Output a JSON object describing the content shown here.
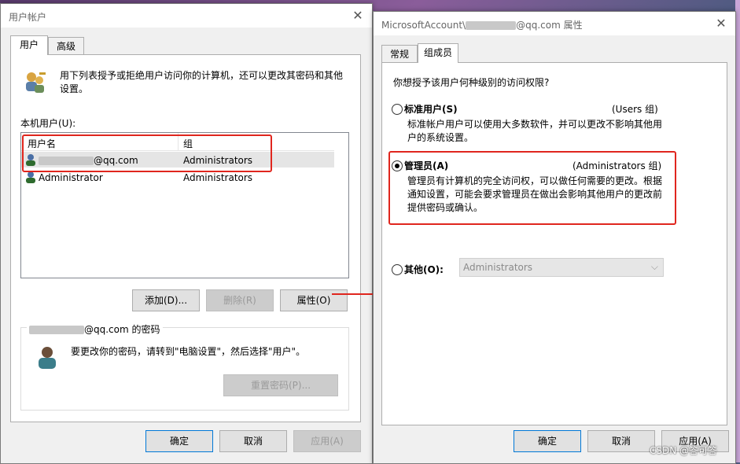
{
  "taskbar_right": {
    "watermark": "CSDN @答可答"
  },
  "left_dialog": {
    "title": "用户帐户",
    "tabs": [
      "用户",
      "高级"
    ],
    "intro": "用下列表授予或拒绝用户访问你的计算机，还可以更改其密码和其他设置。",
    "users_label": "本机用户(U):",
    "columns": [
      "用户名",
      "组"
    ],
    "rows": [
      {
        "name": "@qq.com",
        "group": "Administrators"
      },
      {
        "name": "Administrator",
        "group": "Administrators"
      }
    ],
    "buttons": {
      "add": "添加(D)...",
      "remove": "删除(R)",
      "properties": "属性(O)"
    },
    "password_group_suffix": "@qq.com 的密码",
    "password_text": "要更改你的密码，请转到\"电脑设置\"，然后选择\"用户\"。",
    "reset_button": "重置密码(P)...",
    "footer": {
      "ok": "确定",
      "cancel": "取消",
      "apply": "应用(A)"
    }
  },
  "right_dialog": {
    "title_prefix": "MicrosoftAccount\\",
    "title_suffix": "@qq.com 属性",
    "tabs": [
      "常规",
      "组成员"
    ],
    "question": "你想授予该用户何种级别的访问权限?",
    "standard": {
      "label": "标准用户(S)",
      "group": "(Users 组)",
      "desc": "标准帐户用户可以使用大多数软件，并可以更改不影响其他用户的系统设置。"
    },
    "admin": {
      "label": "管理员(A)",
      "group": "(Administrators 组)",
      "desc": "管理员有计算机的完全访问权，可以做任何需要的更改。根据通知设置，可能会要求管理员在做出会影响其他用户的更改前提供密码或确认。"
    },
    "other": {
      "label": "其他(O):",
      "select_value": "Administrators"
    },
    "selected": "admin",
    "footer": {
      "ok": "确定",
      "cancel": "取消",
      "apply": "应用(A)"
    }
  },
  "colors": {
    "highlight": "#e0261e",
    "arrow": "#e0261e"
  }
}
